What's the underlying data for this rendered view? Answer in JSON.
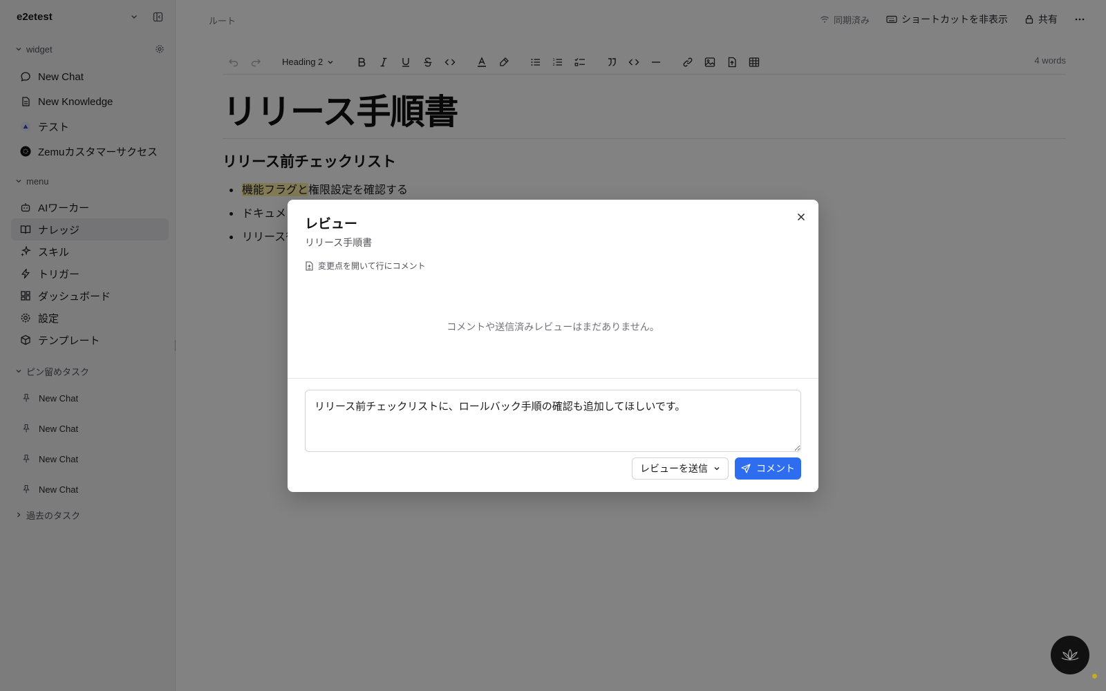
{
  "sidebar": {
    "workspace": "e2etest",
    "widget_section": "widget",
    "widget_items": [
      {
        "label": "New Chat",
        "icon": "chat-bubble-icon"
      },
      {
        "label": "New Knowledge",
        "icon": "document-icon"
      },
      {
        "label": "テスト",
        "icon": "avatar-icon"
      },
      {
        "label": "Zemuカスタマーサクセス",
        "icon": "logo-icon"
      }
    ],
    "menu_section": "menu",
    "menu_items": [
      {
        "label": "AIワーカー",
        "icon": "robot-icon"
      },
      {
        "label": "ナレッジ",
        "icon": "book-icon",
        "active": true
      },
      {
        "label": "スキル",
        "icon": "sparkle-icon"
      },
      {
        "label": "トリガー",
        "icon": "bolt-icon"
      },
      {
        "label": "ダッシュボード",
        "icon": "grid-icon"
      },
      {
        "label": "設定",
        "icon": "gear-icon"
      },
      {
        "label": "テンプレート",
        "icon": "package-icon"
      }
    ],
    "pinned_section": "ピン留めタスク",
    "pinned_items": [
      "New Chat",
      "New Chat",
      "New Chat",
      "New Chat"
    ],
    "past_section": "過去のタスク"
  },
  "header": {
    "breadcrumb": "ルート",
    "sync_status": "同期済み",
    "shortcut_toggle": "ショートカットを非表示",
    "share": "共有"
  },
  "toolbar": {
    "heading_select": "Heading 2",
    "word_count": "4 words"
  },
  "document": {
    "title": "リリース手順書",
    "section_heading": "リリース前チェックリスト",
    "list_items": [
      {
        "highlight": "機能フラグと",
        "rest": "権限設定を確認する"
      },
      {
        "highlight": "",
        "rest": "ドキュメ"
      },
      {
        "highlight": "",
        "rest": "リリース後"
      }
    ]
  },
  "modal": {
    "title": "レビュー",
    "subtitle": "リリース手順書",
    "diff_link": "変更点を開いて行にコメント",
    "empty_message": "コメントや送信済みレビューはまだありません。",
    "comment_value": "リリース前チェックリストに、ロールバック手順の確認も追加してほしいです。",
    "review_button": "レビューを送信",
    "comment_button": "コメント"
  },
  "colors": {
    "accent": "#2f6df0",
    "highlight": "#fdf0a6",
    "overlay": "rgba(0,0,0,0.49)"
  }
}
